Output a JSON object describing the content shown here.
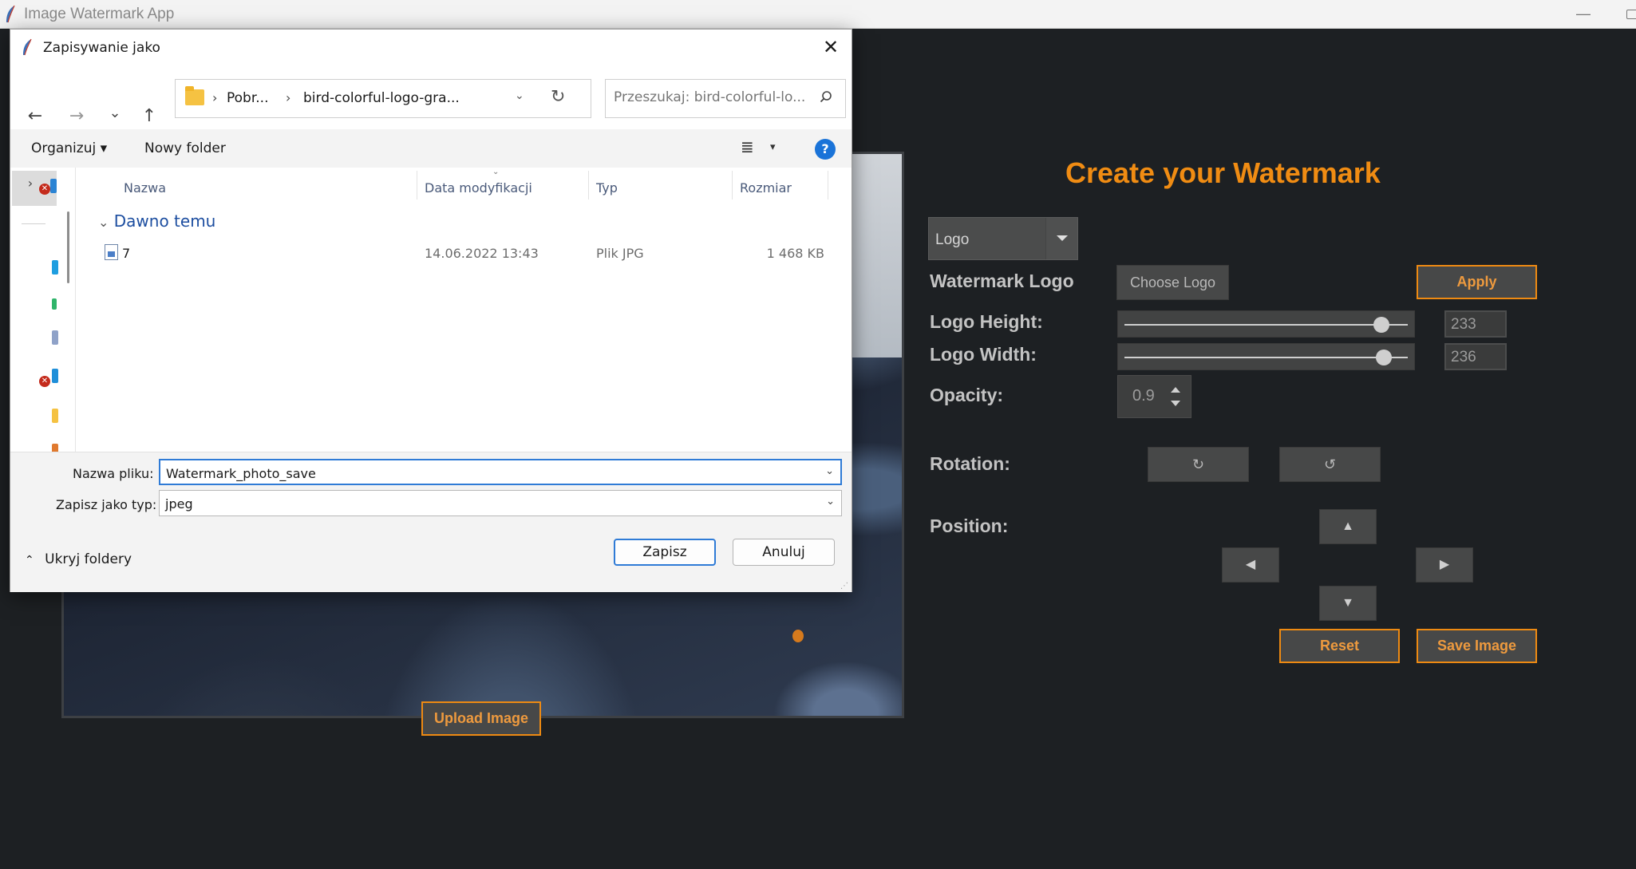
{
  "app": {
    "title": "Image Watermark App",
    "minimize_glyph": "—",
    "upload_label": "Upload Image",
    "heading": "Create your Watermark",
    "type_dropdown": "Logo",
    "watermark_logo_label": "Watermark Logo",
    "choose_logo_label": "Choose Logo",
    "apply_label": "Apply",
    "logo_height_label": "Logo Height:",
    "logo_height_value": "233",
    "logo_height_slider": 0.93,
    "logo_width_label": "Logo Width:",
    "logo_width_value": "236",
    "logo_width_slider": 0.94,
    "opacity_label": "Opacity:",
    "opacity_value": "0.9",
    "rotation_label": "Rotation:",
    "rotate_cw_glyph": "↻",
    "rotate_ccw_glyph": "↺",
    "position_label": "Position:",
    "arrow_up": "▲",
    "arrow_down": "▼",
    "arrow_left": "◀",
    "arrow_right": "▶",
    "reset_label": "Reset",
    "save_image_label": "Save Image",
    "accent_color": "#ee8a12"
  },
  "dialog": {
    "title": "Zapisywanie jako",
    "close_glyph": "✕",
    "nav": {
      "back": "←",
      "forward": "→",
      "recent": "⌄",
      "up": "↑"
    },
    "breadcrumb": [
      "Pobr...",
      "bird-colorful-logo-gra..."
    ],
    "breadcrumb_sep": "›",
    "search_placeholder": "Przeszukaj: bird-colorful-lo...",
    "toolbar": {
      "organize": "Organizuj ▾",
      "new_folder": "Nowy folder",
      "view_glyph": "≣",
      "view_arrow": "▾",
      "help": "?"
    },
    "columns": {
      "name": "Nazwa",
      "date": "Data modyfikacji",
      "type": "Typ",
      "size": "Rozmiar"
    },
    "group": "Dawno temu",
    "files": [
      {
        "name": "7",
        "date": "14.06.2022 13:43",
        "type": "Plik JPG",
        "size": "1 468 KB"
      }
    ],
    "filename_label": "Nazwa pliku:",
    "filename_value": "Watermark_photo_save",
    "filetype_label": "Zapisz jako typ:",
    "filetype_value": "jpeg",
    "hide_folders": "Ukryj foldery",
    "save_label": "Zapisz",
    "cancel_label": "Anuluj"
  }
}
